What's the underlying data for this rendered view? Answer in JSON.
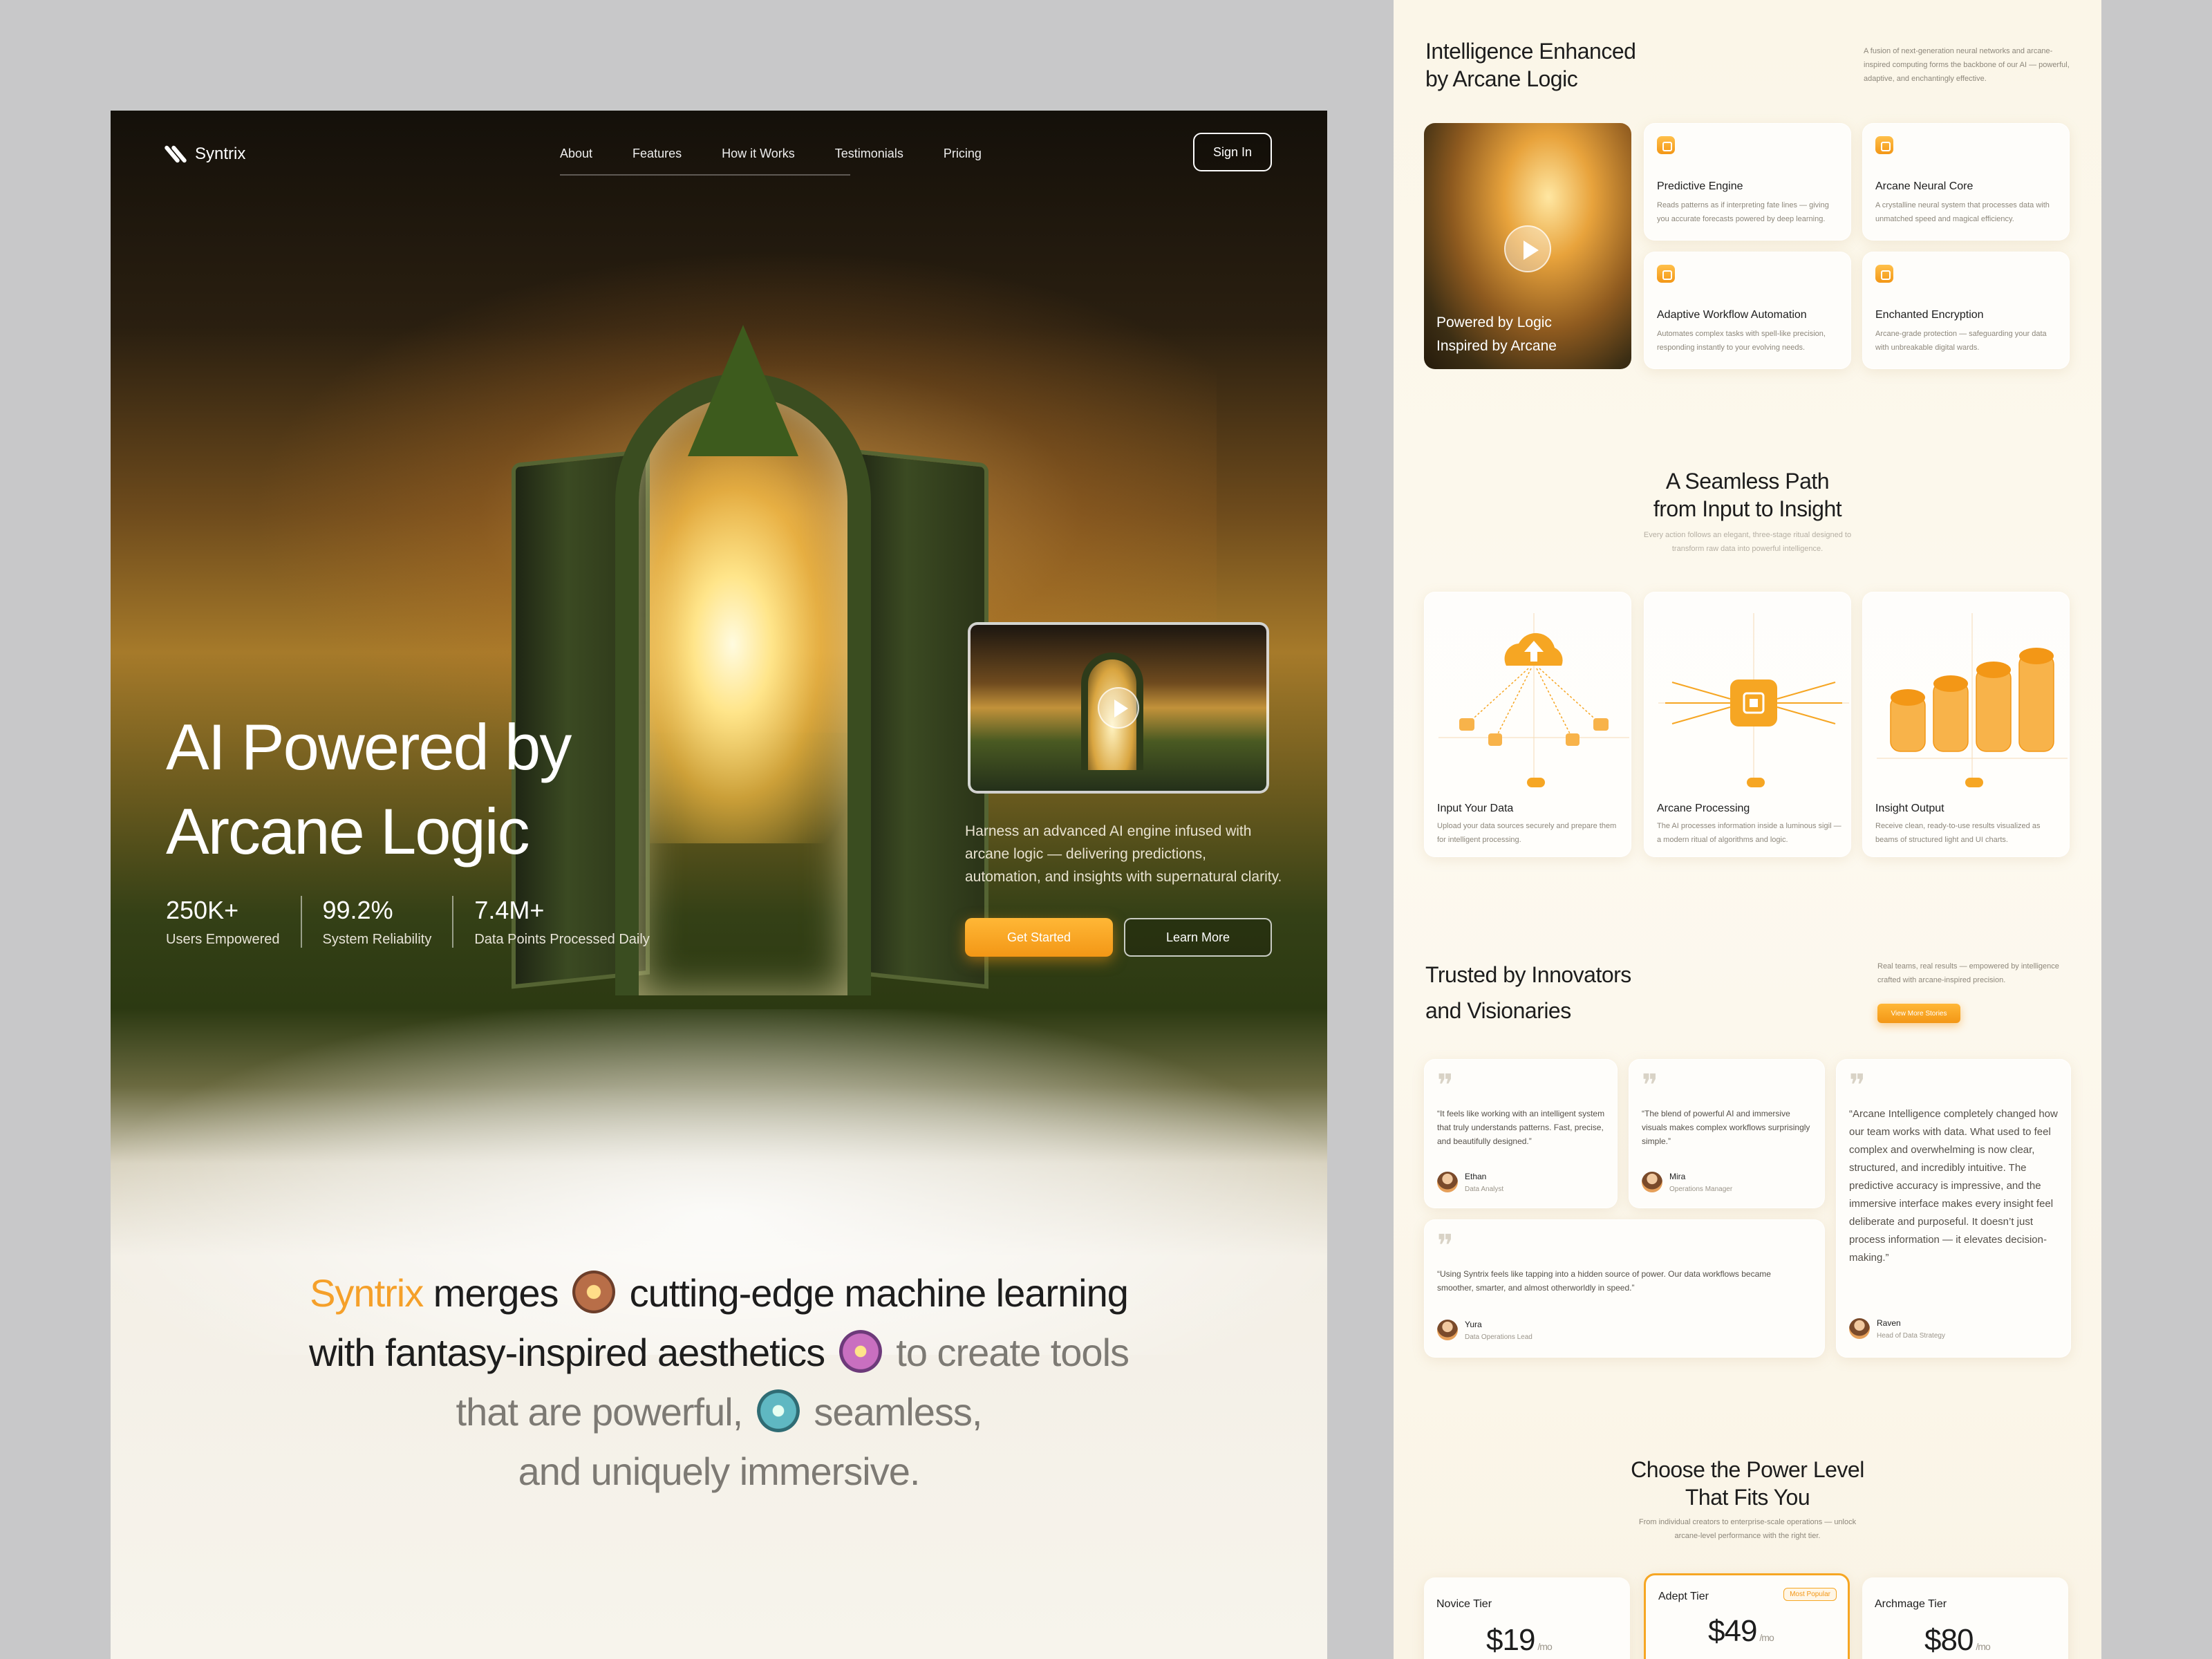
{
  "hero": {
    "brand": "Syntrix",
    "nav": [
      "About",
      "Features",
      "How it Works",
      "Testimonials",
      "Pricing"
    ],
    "signin_label": "Sign In",
    "title_line1": "AI Powered by",
    "title_line2": "Arcane Logic",
    "stats": [
      {
        "value": "250K+",
        "label": "Users Empowered"
      },
      {
        "value": "99.2%",
        "label": "System Reliability"
      },
      {
        "value": "7.4M+",
        "label": "Data Points Processed Daily"
      }
    ],
    "description": "Harness an advanced AI engine infused with arcane logic — delivering predictions, automation, and insights with supernatural clarity.",
    "cta_primary": "Get Started",
    "cta_secondary": "Learn More"
  },
  "manifesto": {
    "brand": "Syntrix",
    "part1": " merges ",
    "part2": " cutting-edge machine learning",
    "part3": "with fantasy-inspired aesthetics ",
    "part4": " to create tools",
    "part5": "that are powerful, ",
    "part6": " seamless,",
    "part7": "and uniquely immersive."
  },
  "features": {
    "title_line1": "Intelligence Enhanced",
    "title_line2": "by Arcane Logic",
    "intro": "A fusion of next-generation neural networks and arcane-inspired computing forms the backbone of our AI — powerful, adaptive, and enchantingly effective.",
    "video_caption_line1": "Powered by Logic",
    "video_caption_line2": "Inspired by Arcane",
    "items": [
      {
        "title": "Predictive Engine",
        "desc": "Reads patterns as if interpreting fate lines — giving you accurate forecasts powered by deep learning."
      },
      {
        "title": "Arcane Neural Core",
        "desc": "A crystalline neural system that processes data with unmatched speed and magical efficiency."
      },
      {
        "title": "Adaptive Workflow Automation",
        "desc": "Automates complex tasks with spell-like precision, responding instantly to your evolving needs."
      },
      {
        "title": "Enchanted Encryption",
        "desc": "Arcane-grade protection — safeguarding your data with unbreakable digital wards."
      }
    ]
  },
  "steps": {
    "title_line1": "A Seamless Path",
    "title_line2": "from Input to Insight",
    "intro": "Every action follows an elegant, three-stage ritual designed to transform raw data into powerful intelligence.",
    "items": [
      {
        "title": "Input Your Data",
        "desc": "Upload your data sources securely and prepare them for intelligent processing."
      },
      {
        "title": "Arcane Processing",
        "desc": "The AI processes information inside a luminous sigil — a modern ritual of algorithms and logic."
      },
      {
        "title": "Insight Output",
        "desc": "Receive clean, ready-to-use results visualized as beams of structured light and UI charts."
      }
    ]
  },
  "testimonials": {
    "title_line1": "Trusted by Innovators",
    "title_line2": "and Visionaries",
    "intro": "Real teams, real results — empowered by intelligence crafted with arcane-inspired precision.",
    "view_more": "View More Stories",
    "items": [
      {
        "quote": "“It feels like working with an intelligent system that truly understands patterns. Fast, precise, and beautifully designed.”",
        "name": "Ethan",
        "role": "Data Analyst"
      },
      {
        "quote": "“The blend of powerful AI and immersive visuals makes complex workflows surprisingly simple.”",
        "name": "Mira",
        "role": "Operations Manager"
      },
      {
        "quote": "“Using Syntrix feels like tapping into a hidden source of power. Our data workflows became smoother, smarter, and almost otherworldly in speed.”",
        "name": "Yura",
        "role": "Data Operations Lead"
      },
      {
        "quote": "“Arcane Intelligence completely changed how our team works with data. What used to feel complex and overwhelming is now clear, structured, and incredibly intuitive. The predictive accuracy is impressive, and the immersive interface makes every insight feel deliberate and purposeful. It doesn’t just process information — it elevates decision-making.”",
        "name": "Raven",
        "role": "Head of Data Strategy"
      }
    ]
  },
  "pricing": {
    "title_line1": "Choose the Power Level",
    "title_line2": "That Fits You",
    "intro": "From individual creators to enterprise-scale operations — unlock arcane-level performance with the right tier.",
    "per": "/mo",
    "badge": "Most Popular",
    "tiers": [
      {
        "name": "Novice Tier",
        "price": "$19"
      },
      {
        "name": "Adept Tier",
        "price": "$49"
      },
      {
        "name": "Archmage Tier",
        "price": "$80"
      }
    ]
  },
  "colors": {
    "accent": "#f6a623",
    "accent_dark": "#f39716",
    "panel_bg": "#fbf6e8"
  }
}
